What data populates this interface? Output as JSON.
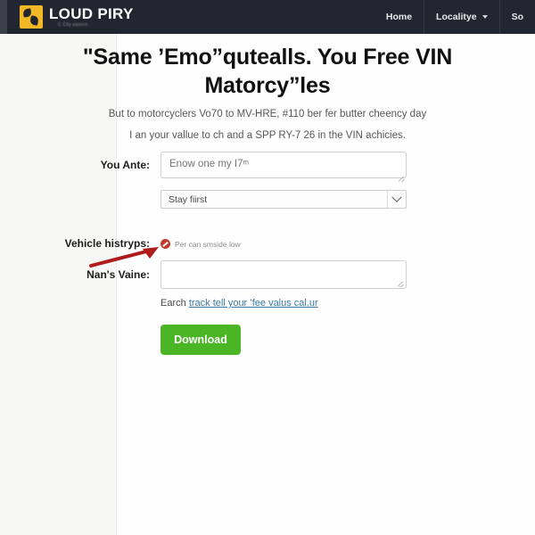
{
  "navbar": {
    "brand": {
      "name": "LOUD PIRY",
      "tagline": "C City oassco"
    },
    "items": [
      {
        "label": "Home",
        "icon": null
      },
      {
        "label": "Localitye",
        "icon": "chevron-down-icon"
      },
      {
        "label": "So",
        "icon": null
      }
    ]
  },
  "main": {
    "headline_line1": "\"Same ’Emo”qutealls. You Free VIN",
    "headline_line2": "Matorcy”les",
    "subtitle_line1": "But to motorcyclers Vo70 to  MV-HRE, #110 ber fer butter cheency day",
    "subtitle_line2": "I an your vallue to ch and a SPP RY-7 26 in the VIN achicies."
  },
  "form": {
    "fields": [
      {
        "label": "You Ante:",
        "type": "textarea",
        "value": "",
        "placeholder": "Enow one my I7ᵐ"
      },
      {
        "label": "",
        "type": "select",
        "selected": "Stay fiirst",
        "icon": "chevron-down-icon"
      },
      {
        "label": "Vehicle histryps:",
        "type": "error",
        "icon": "error-slash-icon",
        "message": "Per can smside low"
      },
      {
        "label": "Nan's Vaine:",
        "type": "text",
        "value": "",
        "placeholder": ""
      }
    ],
    "helper_prefix": "Earch",
    "helper_link": "track tell your ’fee valus cal.ur",
    "submit_label": "Download"
  },
  "colors": {
    "navbar_bg": "#222630",
    "brand_mark": "#f2b826",
    "download_green": "#4cb526",
    "error_red": "#c0392b",
    "link_blue": "#3878a8",
    "annotation_red": "#b01b1b"
  }
}
